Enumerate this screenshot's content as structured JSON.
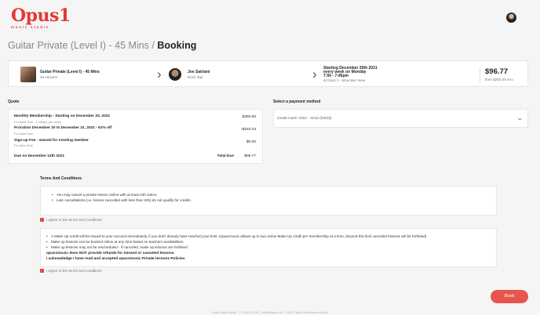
{
  "brand": {
    "name": "Opus1",
    "tagline": "music studio"
  },
  "page": {
    "title_prefix": "Guitar Private (Level I) - 45 Mins /",
    "title_main": "Booking"
  },
  "summary": {
    "lesson_title": "Guitar Private (Level I) - 45 Mins",
    "lesson_duration": "45 minutes",
    "teacher_name": "Joe Satriani",
    "teacher_role": "Rock Star",
    "schedule_line1": "Starting December 20th 2021",
    "schedule_line2": "every week on Monday",
    "schedule_line3": "7:00 - 7:45pm",
    "schedule_location": "at Opus 1 - Mountain View",
    "price": "$96.77",
    "price_sub": "then $250.00 /mo"
  },
  "quote": {
    "heading": "Quote",
    "lines": [
      {
        "label": "Monthly Membership - Starting on December 20, 2021",
        "sub": "For Alice Doe - 1 visit(s) per week",
        "amount": "$250.00"
      },
      {
        "label": "Proration December 20 to December 31, 2021 - 61% off",
        "sub": "For Alice Doe",
        "amount": "-$153.23"
      },
      {
        "label": "Sign-up Fee - waived for existing member",
        "sub": "For Alice Doe",
        "amount": "$0.00"
      }
    ],
    "due_label": "Due on December 14th 2021",
    "total_label": "Total Due",
    "total_value": "$96.77"
  },
  "payment": {
    "heading": "Select a payment method",
    "selected": "Credit Card: VISA - 4242 (04/23)"
  },
  "terms": {
    "heading": "Terms And Conditions",
    "items": [
      "You may cancel a private lesson online with at least 24h notice.",
      "Late cancellations (i.e. lesson cancelled with less than 24h) do not qualify for credits."
    ],
    "agree_label": "I agree to the terms and conditions"
  },
  "policies": {
    "items": [
      "A Make Up credit will be issued to your account immediately, if you don't already have reached your limit. (opus1music allows up to two active Make Up credit per membership at a time, beyond this limit canceled lessons will be forfeited)",
      "Make up lessons can be booked online at any time based on teachers availabilities.",
      "Make up lessons may not be rescheduled - if canceled, make up lessons are forfeited."
    ],
    "bold1": "opus1music does NOT provide refunds for missed or canceled lessons.",
    "bold2": "I acknowledge I have read and accepted opus1music Private lessons Policies",
    "agree_label": "I agree to the terms and conditions"
  },
  "actions": {
    "book_label": "Book"
  },
  "footer": {
    "text": "Opus1 Music Studio · © 1-800-OPUS1 · admin@opus1.io · © 2021 Opus1 Development Studio"
  },
  "colors": {
    "accent": "#e53935",
    "button": "#e8554f"
  }
}
